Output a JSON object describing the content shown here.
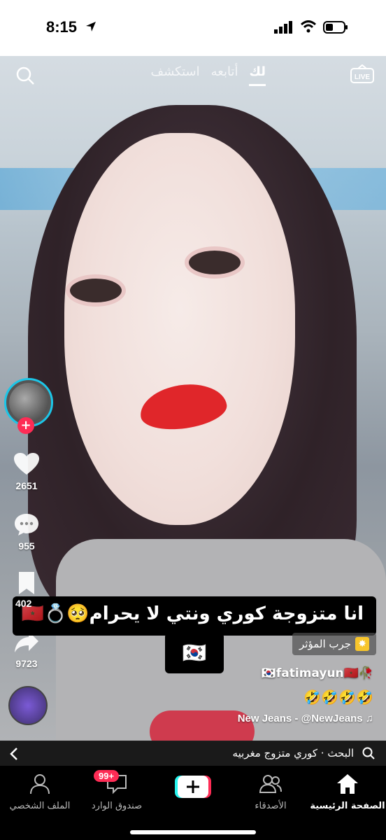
{
  "status": {
    "time": "8:15"
  },
  "top_nav": {
    "tabs": [
      {
        "label": "لك",
        "active": true
      },
      {
        "label": "أتابعه",
        "active": false
      },
      {
        "label": "استكشف",
        "active": false
      }
    ],
    "live_label": "LIVE"
  },
  "rail": {
    "likes": "2651",
    "comments": "955",
    "saves": "402",
    "shares": "9723"
  },
  "caption": {
    "line1": "انا متزوجة كوري ونتي لا يحرام🥺💍🇲🇦",
    "line2": "🇰🇷"
  },
  "effect": {
    "label": "جرب المؤثر"
  },
  "author": {
    "username": "🇰🇷fatimayun🇲🇦🥀"
  },
  "description": "🤣🤣🤣🤣",
  "sound": "New Jeans - @NewJeans ♫",
  "search_bar": {
    "text": "البحث · كوري متزوج مغربيه"
  },
  "bottom_nav": {
    "items": [
      {
        "label": "الصفحة الرئيسية",
        "active": true
      },
      {
        "label": "الأصدقاء",
        "active": false
      },
      {
        "label": "صندوق الوارد",
        "badge": "99+",
        "active": false
      },
      {
        "label": "الملف الشخصي",
        "active": false
      }
    ]
  },
  "colors": {
    "accent": "#fe2c55",
    "cyan": "#25f4ee"
  }
}
